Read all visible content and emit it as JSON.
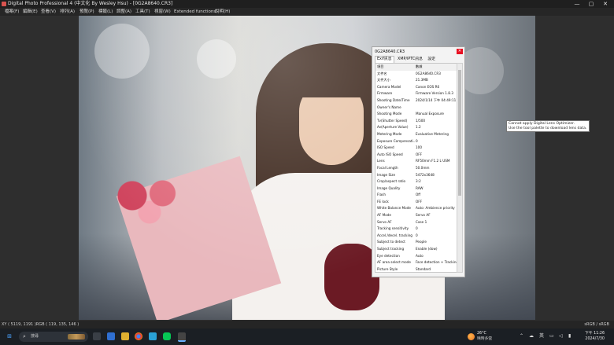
{
  "window": {
    "title": "Digital Photo Professional 4 (中文化 By Wesley Hsu) - [0G2A8640.CR3]",
    "min_glyph": "—",
    "max_glyph": "▢",
    "close_glyph": "✕"
  },
  "menu": [
    "檔案(F)",
    "編輯(E)",
    "查看(V)",
    "排列(A)",
    "預覽(P)",
    "標籤(L)",
    "調整(A)",
    "工具(T)",
    "視窗(W)",
    "Extended functions",
    "說明(H)"
  ],
  "exif_dialog": {
    "title": "0G2A8640.CR3",
    "close_glyph": "✕",
    "tabs": [
      "Exif訊息",
      "XMP/IPTC訊息",
      "設定"
    ],
    "active_tab": 0,
    "header": {
      "key": "項目",
      "value": "數據"
    },
    "rows": [
      {
        "key": "文件名",
        "value": "0G2A8640.CR3"
      },
      {
        "key": "文件大小",
        "value": "21.3MB"
      },
      {
        "key": "Camera Model",
        "value": "Canon EOS R6"
      },
      {
        "key": "Firmware",
        "value": "Firmware Version 1.8.3"
      },
      {
        "key": "Shooting Date/Time",
        "value": "2024/1/14 下午 04:49:11"
      },
      {
        "key": "Owner's Name",
        "value": ""
      },
      {
        "key": "Shooting Mode",
        "value": "Manual Exposure"
      },
      {
        "key": "Tv(Shutter Speed)",
        "value": "1/500"
      },
      {
        "key": "Av(Aperture Value)",
        "value": "1.2"
      },
      {
        "key": "Metering Mode",
        "value": "Evaluative Metering"
      },
      {
        "key": "Exposure Compensati...",
        "value": "0"
      },
      {
        "key": "ISO Speed",
        "value": "100"
      },
      {
        "key": "Auto ISO Speed",
        "value": "OFF"
      },
      {
        "key": "Lens",
        "value": "RF50mm F1.2 L USM"
      },
      {
        "key": "Focal Length",
        "value": "50.0mm"
      },
      {
        "key": "Image Size",
        "value": "5472x3648"
      },
      {
        "key": "Crop/aspect ratio",
        "value": "3:2"
      },
      {
        "key": "Image Quality",
        "value": "RAW"
      },
      {
        "key": "Flash",
        "value": "Off"
      },
      {
        "key": "FE lock",
        "value": "OFF"
      },
      {
        "key": "White Balance Mode",
        "value": "Auto: Ambience priority"
      },
      {
        "key": "AF Mode",
        "value": "Servo AF"
      },
      {
        "key": "Servo AF",
        "value": "Case 1"
      },
      {
        "key": "Tracking sensitivity",
        "value": "0"
      },
      {
        "key": "Accel./decel. tracking",
        "value": "0"
      },
      {
        "key": "Subject to detect",
        "value": "People"
      },
      {
        "key": "Subject tracking",
        "value": "Enable (dow)"
      },
      {
        "key": "Eye detection",
        "value": "Auto"
      },
      {
        "key": "AF area select mode",
        "value": "Face detection + Tracking AF"
      },
      {
        "key": "Picture Style",
        "value": "Standard"
      }
    ]
  },
  "tooltip": {
    "line1": "Cannot apply Digital Lens Optimizer.",
    "line2": "Use the tool palette to download lens data."
  },
  "statusbar": {
    "coords": "XY ( 5119, 1191 )RGB ( 119, 135, 146 )",
    "colorspace": "sRGB / sRGB"
  },
  "taskbar": {
    "search_placeholder": "搜尋",
    "weather_temp": "26°C",
    "weather_cond": "晴時多雲",
    "ime": "英",
    "time": "下午 11:26",
    "date": "2024/7/30"
  },
  "colors": {
    "titlebar_bg": "#1f1f1f",
    "taskbar_bg": "#1b1f24",
    "dialog_close": "#e81123"
  }
}
